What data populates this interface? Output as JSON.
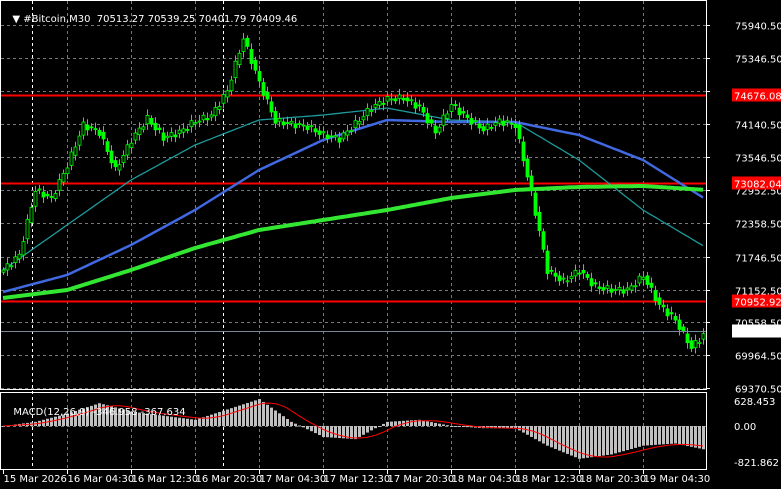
{
  "header": {
    "symbol": "#Bitcoin,M30",
    "open": "70513.27",
    "high": "70539.25",
    "low": "70401.79",
    "close": "70409.46"
  },
  "macd": {
    "label": "MACD(12,26,9)",
    "main_value": "-346.958",
    "signal_value": "-367.634",
    "axis_labels": [
      "628.453",
      "0.00",
      "-821.862"
    ]
  },
  "colors": {
    "background": "#000000",
    "bull_candle": "#00ff00",
    "level_line": "#ff0000",
    "ma_fast": "#1f9a9a",
    "ma_mid": "#4169e1",
    "ma_slow": "#32e632",
    "macd_hist": "#c0c0c0",
    "macd_signal": "#ff0000",
    "current_price_line": "#778899"
  },
  "chart_data": {
    "type": "candlestick",
    "timeframe": "M30",
    "start_time": "15 Mar 2026 20:30",
    "close_step": "2h",
    "closes": [
      71506,
      71778,
      72954,
      72800,
      73400,
      74130,
      74000,
      73316,
      73859,
      74250,
      73900,
      74000,
      74200,
      74300,
      74750,
      75700,
      74900,
      74200,
      74150,
      74100,
      73950,
      73880,
      74150,
      74450,
      74600,
      74620,
      74450,
      74000,
      74500,
      74250,
      74050,
      74200,
      74130,
      72900,
      71500,
      71300,
      71500,
      71200,
      71150,
      71144,
      71400,
      70870,
      70600,
      70100,
      70409
    ],
    "ma_step": "8h",
    "moving_averages": [
      {
        "color_key": "ma_fast",
        "values": [
          71506,
          72320,
          73135,
          73768,
          74221,
          74311,
          74438,
          74221,
          74185,
          73497,
          72592,
          71904
        ]
      },
      {
        "color_key": "ma_mid",
        "values": [
          71108,
          71415,
          71958,
          72592,
          73316,
          73859,
          74221,
          74185,
          74185,
          73949,
          73497,
          72773
        ]
      },
      {
        "color_key": "ma_slow",
        "values": [
          70999,
          71144,
          71506,
          71904,
          72230,
          72411,
          72592,
          72809,
          72954,
          73009,
          73027,
          72954
        ]
      }
    ],
    "levels": [
      {
        "label": "74676.08",
        "value": 74676.08
      },
      {
        "label": "73082.04",
        "value": 73082.04
      },
      {
        "label": "70952.92",
        "value": 70952.92
      }
    ],
    "current_price": {
      "label": "70403.46",
      "value": 70403.46
    },
    "y_ticks": [
      "75940.50",
      "75346.50",
      "74752.50",
      "74140.50",
      "73546.50",
      "72952.50",
      "72358.50",
      "71746.50",
      "71152.50",
      "70558.50",
      "69964.50",
      "69370.50"
    ],
    "ylim": [
      69370.5,
      75940.5
    ],
    "x_ticks": [
      "15 Mar 2026",
      "16 Mar 04:30",
      "16 Mar 12:30",
      "16 Mar 20:30",
      "17 Mar 04:30",
      "17 Mar 12:30",
      "17 Mar 20:30",
      "18 Mar 04:30",
      "18 Mar 12:30",
      "18 Mar 20:30",
      "19 Mar 04:30"
    ],
    "grid": true,
    "macd_hist_step": "4h",
    "macd_hist": [
      0,
      100,
      300,
      550,
      350,
      250,
      150,
      400,
      650,
      100,
      -250,
      -300,
      100,
      150,
      0,
      -50,
      -50,
      -450,
      -750,
      -650,
      -450,
      -400,
      -550
    ],
    "macd_ylim": [
      -821.862,
      628.453
    ]
  }
}
